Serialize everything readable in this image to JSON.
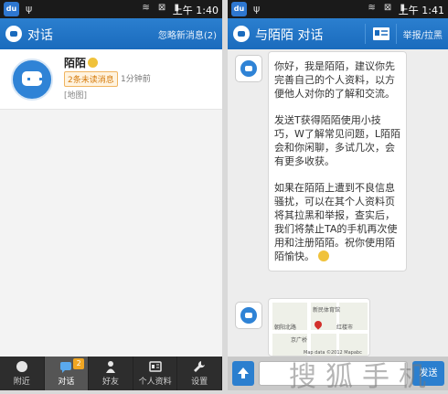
{
  "left": {
    "status": {
      "app": "du",
      "time": "上午 1:40"
    },
    "header": {
      "title": "对话",
      "action": "忽略新消息(2)"
    },
    "conversations": [
      {
        "name": "陌陌",
        "badge": "2条未读消息",
        "time": "1分钟前",
        "preview": "[地图]"
      }
    ],
    "tabs": [
      {
        "label": "附近",
        "icon": "location-dot-icon"
      },
      {
        "label": "对话",
        "icon": "chat-bubble-icon",
        "count": "2",
        "active": true
      },
      {
        "label": "好友",
        "icon": "person-icon"
      },
      {
        "label": "个人资料",
        "icon": "profile-card-icon"
      },
      {
        "label": "设置",
        "icon": "wrench-icon"
      }
    ]
  },
  "right": {
    "status": {
      "app": "du",
      "time": "上午 1:41"
    },
    "header": {
      "title": "与陌陌 对话",
      "action": "举报/拉黑"
    },
    "messages": [
      "你好，我是陌陌，建议你先完善自己的个人资料，以方便他人对你的了解和交流。",
      "发送T获得陌陌使用小技巧，W了解常见问题，L陌陌会和你闲聊，多试几次，会有更多收获。",
      "如果在陌陌上遭到不良信息骚扰，可以在其个人资料页将其拉黑和举报，查实后，我们将禁止TA的手机再次使用和注册陌陌。祝你使用陌陌愉快。"
    ],
    "map_labels": [
      "新民体育馆",
      "红楼市",
      "京广桥",
      "朝阳北路"
    ],
    "map_copyright": "Map data ©2012 Mapabc",
    "input": {
      "send_label": "发送"
    }
  },
  "watermark": "搜狐手机"
}
